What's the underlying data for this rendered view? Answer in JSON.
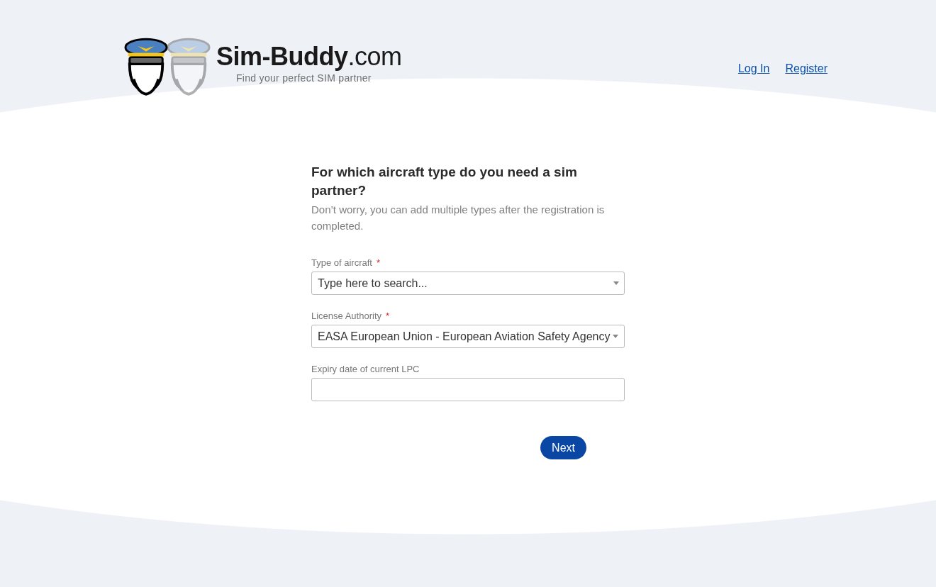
{
  "header": {
    "logo_text": "**Sim-Buddy**.com",
    "tagline": "Find your perfect SIM partner",
    "links": [
      "Log In",
      "Register"
    ]
  },
  "form": {
    "heading": "For which aircraft type do you need a sim partner?",
    "subtext": "Don’t worry, you can add multiple types after the registration is completed.",
    "fields": [
      {
        "kind": "select",
        "label": "Type of aircraft",
        "required": true,
        "placeholder": "Type here to search..."
      },
      {
        "kind": "select",
        "label": "License Authority",
        "required": true,
        "value": "EASA European Union - European Aviation Safety Agency"
      },
      {
        "kind": "text",
        "label": "Expiry date of current LPC",
        "required": false
      }
    ],
    "required_mark": "*",
    "submit": "Next"
  }
}
